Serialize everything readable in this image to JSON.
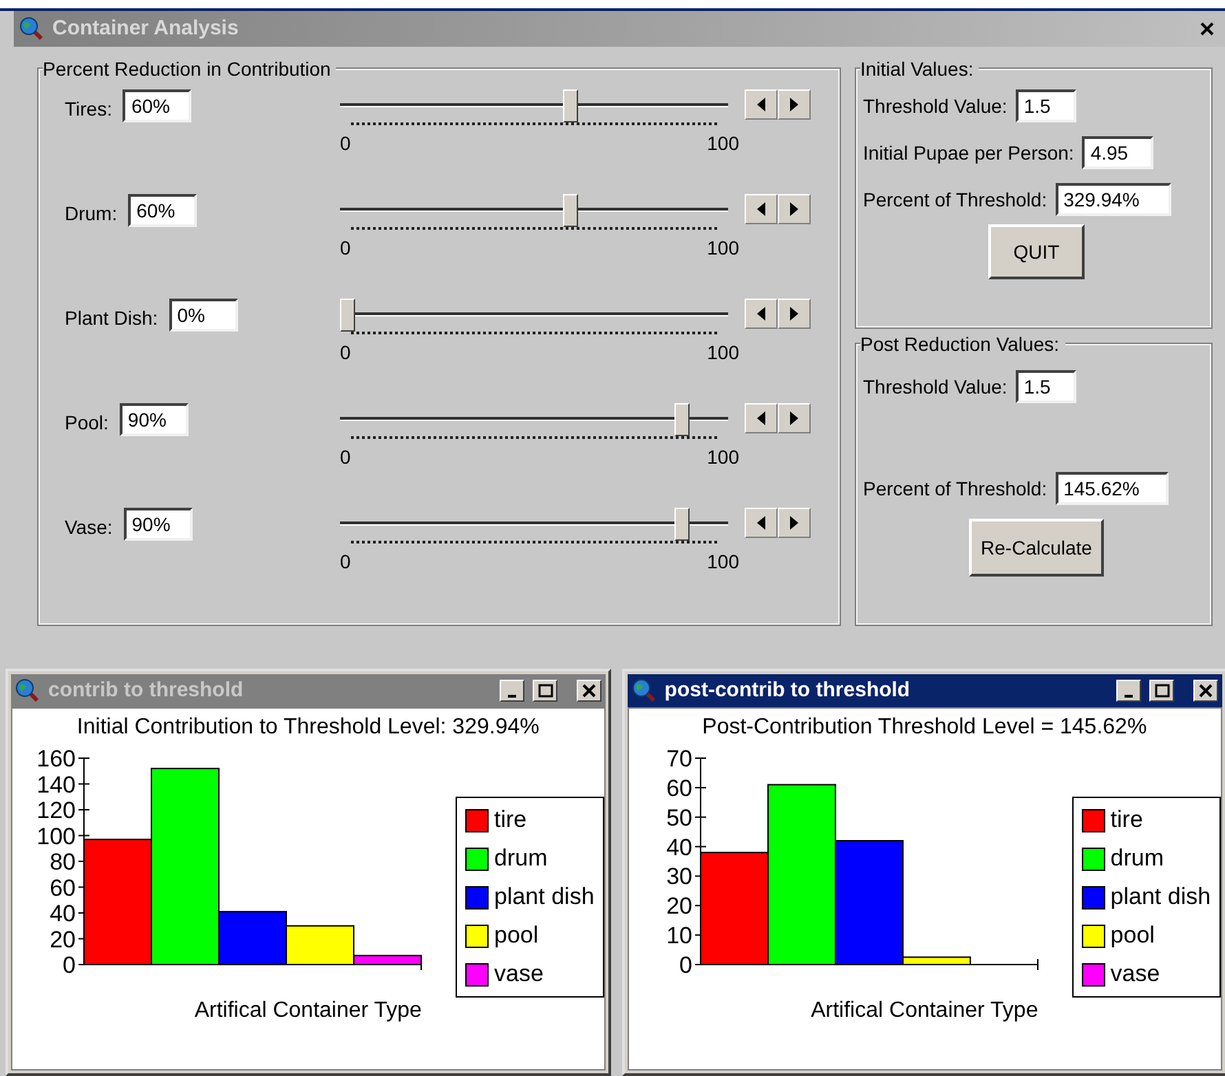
{
  "window": {
    "title": "Container Analysis"
  },
  "reduction": {
    "title": "Percent Reduction in Contribution",
    "sliders": [
      {
        "label": "Tires:",
        "value": "60%",
        "level": 0.6,
        "min": "0",
        "max": "100"
      },
      {
        "label": "Drum:",
        "value": "60%",
        "level": 0.6,
        "min": "0",
        "max": "100"
      },
      {
        "label": "Plant Dish:",
        "value": "0%",
        "level": 0,
        "min": "0",
        "max": "100"
      },
      {
        "label": "Pool:",
        "value": "90%",
        "level": 0.9,
        "min": "0",
        "max": "100"
      },
      {
        "label": "Vase:",
        "value": "90%",
        "level": 0.9,
        "min": "0",
        "max": "100"
      }
    ]
  },
  "initial_values": {
    "title": "Initial Values:",
    "fields": [
      {
        "label": "Threshold Value:",
        "value": "1.5"
      },
      {
        "label": "Initial Pupae per Person:",
        "value": "4.95"
      },
      {
        "label": "Percent of Threshold:",
        "value": "329.94%"
      }
    ],
    "button": "QUIT"
  },
  "post_values": {
    "title": "Post Reduction Values:",
    "fields": [
      {
        "label": "Threshold Value:",
        "value": "1.5"
      },
      {
        "label": "Percent of Threshold:",
        "value": "145.62%"
      }
    ],
    "button": "Re-Calculate"
  },
  "chart_windows": [
    {
      "title": "contrib to threshold",
      "active": false,
      "chart_data": {
        "type": "bar",
        "title": "Initial Contribution to Threshold Level: 329.94%",
        "xlabel": "Artifical Container Type",
        "ylim": [
          0,
          160
        ],
        "yticks": [
          0,
          20,
          40,
          60,
          80,
          100,
          120,
          140,
          160
        ],
        "series": [
          {
            "name": "tire",
            "color": "#ff0000",
            "values": [
              97
            ]
          },
          {
            "name": "drum",
            "color": "#00ff00",
            "values": [
              152
            ]
          },
          {
            "name": "plant dish",
            "color": "#0000ff",
            "values": [
              41
            ]
          },
          {
            "name": "pool",
            "color": "#ffff00",
            "values": [
              30
            ]
          },
          {
            "name": "vase",
            "color": "#ff00ff",
            "values": [
              7
            ]
          }
        ]
      }
    },
    {
      "title": "post-contrib to threshold",
      "active": true,
      "chart_data": {
        "type": "bar",
        "title": "Post-Contribution Threshold Level = 145.62%",
        "xlabel": "Artifical Container Type",
        "ylim": [
          0,
          70
        ],
        "yticks": [
          0,
          10,
          20,
          30,
          40,
          50,
          60,
          70
        ],
        "series": [
          {
            "name": "tire",
            "color": "#ff0000",
            "values": [
              38
            ]
          },
          {
            "name": "drum",
            "color": "#00ff00",
            "values": [
              61
            ]
          },
          {
            "name": "plant dish",
            "color": "#0000ff",
            "values": [
              42
            ]
          },
          {
            "name": "pool",
            "color": "#ffff00",
            "values": [
              2.5
            ]
          },
          {
            "name": "vase",
            "color": "#ff00ff",
            "values": [
              0
            ]
          }
        ]
      }
    }
  ]
}
